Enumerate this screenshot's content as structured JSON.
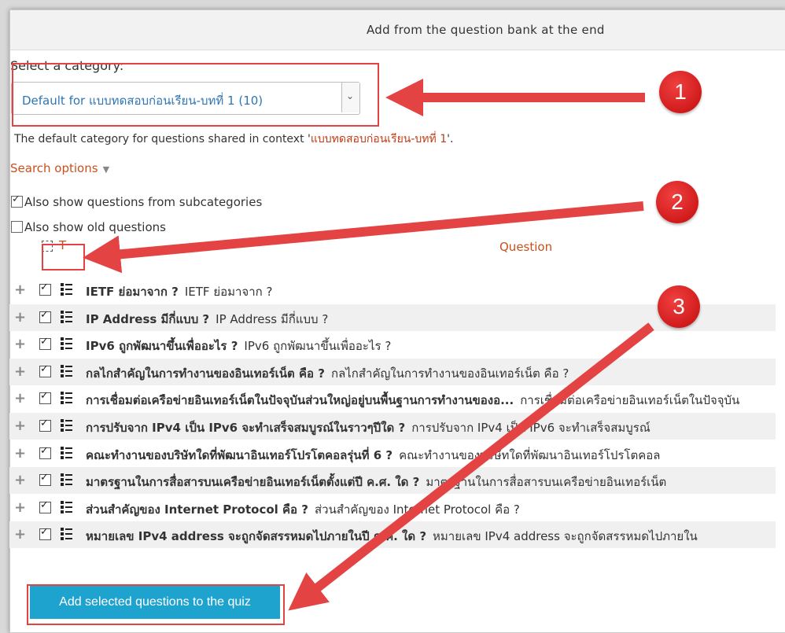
{
  "dialog": {
    "title": "Add from the question bank at the end"
  },
  "category": {
    "label": "Select a category:",
    "selected": "Default for แบบทดสอบก่อนเรียน-บทที่ 1 (10)",
    "context_prefix": "The default category for questions shared in context '",
    "context_name": "แบบทดสอบก่อนเรียน-บทที่ 1",
    "context_suffix": "'."
  },
  "search": {
    "label": "Search options",
    "subcategories": {
      "label": "Also show questions from subcategories",
      "checked": true
    },
    "old_questions": {
      "label": "Also show old questions",
      "checked": false
    }
  },
  "table": {
    "col_type": "T",
    "col_question": "Question",
    "rows": [
      {
        "name": "IETF ย่อมาจาก ?",
        "text": "IETF ย่อมาจาก ?"
      },
      {
        "name": "IP Address มีกี่แบบ ?",
        "text": "IP Address มีกี่แบบ ?"
      },
      {
        "name": "IPv6 ถูกพัฒนาขึ้นเพื่ออะไร ?",
        "text": "IPv6 ถูกพัฒนาขึ้นเพื่ออะไร ?"
      },
      {
        "name": "กลไกสำคัญในการทำงานของอินเทอร์เน็ต คือ ?",
        "text": "กลไกสำคัญในการทำงานของอินเทอร์เน็ต คือ ?"
      },
      {
        "name": "การเชื่อมต่อเครือข่ายอินเทอร์เน็ตในปัจจุบันส่วนใหญ่อยู่บนพื้นฐานการทำงานของอ...",
        "text": "การเชื่อมต่อเครือข่ายอินเทอร์เน็ตในปัจจุบัน"
      },
      {
        "name": "การปรับจาก IPv4 เป็น IPv6 จะทำเสร็จสมบูรณ์ในราวๆปีใด ?",
        "text": "การปรับจาก IPv4 เป็น IPv6 จะทำเสร็จสมบูรณ์"
      },
      {
        "name": "คณะทำงานของบริษัทใดที่พัฒนาอินเทอร์โปรโตคอลรุ่นที่ 6 ?",
        "text": "คณะทำงานของบริษัทใดที่พัฒนาอินเทอร์โปรโตคอล"
      },
      {
        "name": "มาตรฐานในการสื่อสารบนเครือข่ายอินเทอร์เน็ตตั้งแต่ปี ค.ศ. ใด ?",
        "text": "มาตรฐานในการสื่อสารบนเครือข่ายอินเทอร์เน็ต"
      },
      {
        "name": "ส่วนสำคัญของ Internet Protocol คือ ?",
        "text": "ส่วนสำคัญของ Internet Protocol คือ ?"
      },
      {
        "name": "หมายเลข IPv4 address จะถูกจัดสรรหมดไปภายในปี ค.ศ. ใด ?",
        "text": "หมายเลข IPv4 address จะถูกจัดสรรหมดไปภายใน"
      }
    ]
  },
  "add_button": "Add selected questions to the quiz",
  "annotations": {
    "badge1": "1",
    "badge2": "2",
    "badge3": "3"
  },
  "colors": {
    "highlight": "#e34343",
    "button": "#1ea3cf",
    "link": "#c9501c",
    "select_text": "#2f76b4"
  }
}
